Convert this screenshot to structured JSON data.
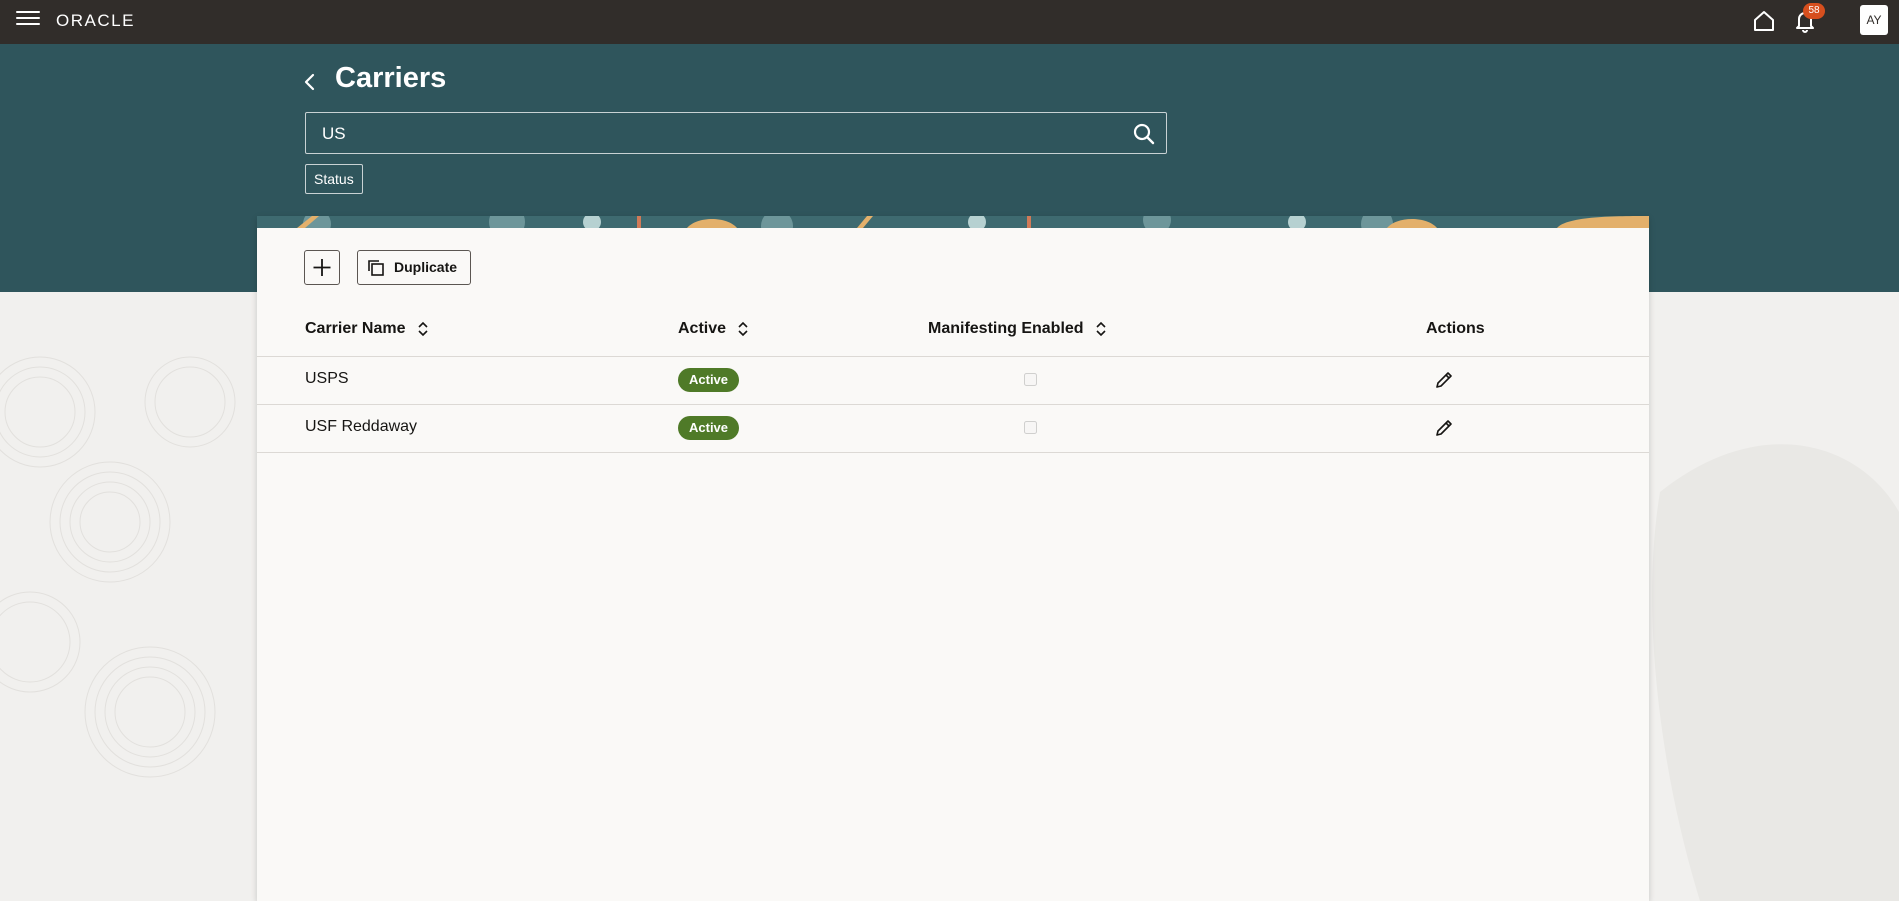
{
  "header": {
    "logo": "ORACLE",
    "notifications_count": "58",
    "avatar_initials": "AY",
    "icons": [
      "menu-icon",
      "home-icon",
      "bell-icon"
    ]
  },
  "page": {
    "title": "Carriers",
    "search_value": "US",
    "filter_chip": "Status"
  },
  "toolbar": {
    "duplicate_label": "Duplicate",
    "icons": [
      "plus-icon",
      "duplicate-icon"
    ]
  },
  "table": {
    "columns": [
      "Carrier Name",
      "Active",
      "Manifesting Enabled",
      "Actions"
    ],
    "rows": [
      {
        "carrier_name": "USPS",
        "active": "Active",
        "manifesting_enabled": false
      },
      {
        "carrier_name": "USF Reddaway",
        "active": "Active",
        "manifesting_enabled": false
      }
    ]
  },
  "colors": {
    "topbar": "#312d2a",
    "hero": "#2f555c",
    "active_pill": "#4f7a28",
    "badge": "#d64f1e",
    "card": "#faf9f7"
  }
}
